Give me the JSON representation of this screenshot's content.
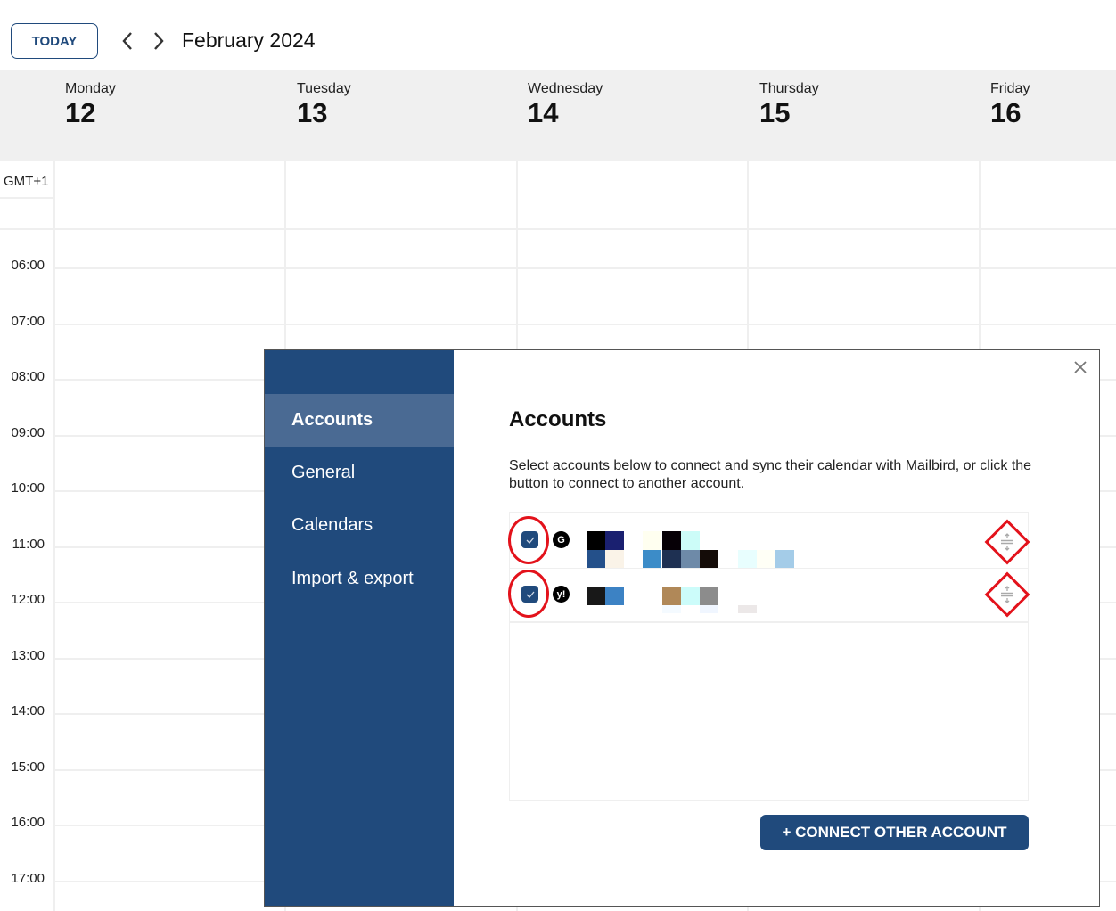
{
  "toolbar": {
    "today_label": "TODAY",
    "prev_icon": "chevron-left-icon",
    "next_icon": "chevron-right-icon",
    "month_title": "February 2024"
  },
  "week": {
    "days": [
      {
        "name": "Monday",
        "num": "12"
      },
      {
        "name": "Tuesday",
        "num": "13"
      },
      {
        "name": "Wednesday",
        "num": "14"
      },
      {
        "name": "Thursday",
        "num": "15"
      },
      {
        "name": "Friday",
        "num": "16"
      }
    ],
    "timezone": "GMT+1",
    "hours": [
      "06:00",
      "07:00",
      "08:00",
      "09:00",
      "10:00",
      "11:00",
      "12:00",
      "13:00",
      "14:00",
      "15:00",
      "16:00",
      "17:00"
    ]
  },
  "settings": {
    "sidebar": {
      "items": [
        {
          "label": "Accounts",
          "active": true
        },
        {
          "label": "General",
          "active": false
        },
        {
          "label": "Calendars",
          "active": false
        },
        {
          "label": "Import & export",
          "active": false
        }
      ]
    },
    "close_icon": "close-icon",
    "title": "Accounts",
    "description": "Select accounts below to connect and sync their calendar with Mailbird, or click the button to connect to another account.",
    "accounts": [
      {
        "provider": "Google",
        "provider_glyph": "G",
        "checked": true,
        "name_redacted": true
      },
      {
        "provider": "Yahoo",
        "provider_glyph": "y!",
        "checked": true,
        "name_redacted": true
      }
    ],
    "connect_button_label": "+ CONNECT OTHER ACCOUNT"
  },
  "colors": {
    "accent": "#204a7c",
    "sidebar_active": "#4a6a93",
    "header_bg": "#f0f0f0",
    "annotation_red": "#e3121b"
  }
}
